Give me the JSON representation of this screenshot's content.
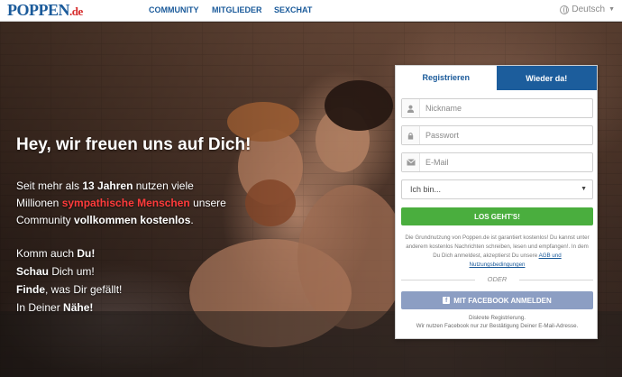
{
  "header": {
    "logo_main": "POPPEN",
    "logo_tld": ".de",
    "nav": [
      "COMMUNITY",
      "MITGLIEDER",
      "SEXCHAT"
    ],
    "language": "Deutsch"
  },
  "hero": {
    "headline": "Hey, wir freuen uns auf Dich!",
    "intro_part1": "Seit mehr als ",
    "intro_years": "13 Jahren",
    "intro_part2": " nutzen viele Millionen ",
    "intro_red": "sympathische Menschen",
    "intro_part3": " unsere Community ",
    "intro_bold_end": "vollkommen kostenlos",
    "intro_dot": ".",
    "cta": [
      {
        "bold": "",
        "plain": "Komm auch ",
        "bold2": "Du!"
      },
      {
        "bold": "Schau",
        "plain": " Dich um!",
        "bold2": ""
      },
      {
        "bold": "Finde",
        "plain": ", was Dir gefällt!",
        "bold2": ""
      },
      {
        "bold": "",
        "plain": "In Deiner ",
        "bold2": "Nähe!"
      }
    ]
  },
  "form": {
    "tab_register": "Registrieren",
    "tab_back": "Wieder da!",
    "nickname_placeholder": "Nickname",
    "password_placeholder": "Passwort",
    "email_placeholder": "E-Mail",
    "select_value": "Ich bin...",
    "submit_label": "LOS GEHT'S!",
    "legal_text": "Die Grundnutzung von Poppen.de ist garantiert kostenlos! Du kannst unter anderem kostenlos Nachrichten schreiben, lesen und empfangen!. In dem Du Dich anmeldest, akzeptierst Du unsere ",
    "legal_link": "AGB und Nutzungsbedingungen",
    "or_label": "ODER",
    "facebook_label": "MIT FACEBOOK ANMELDEN",
    "discreet_line1": "Diskrete Registrierung.",
    "discreet_line2": "Wir nutzen Facebook nur zur Bestätigung Deiner E-Mail-Adresse."
  },
  "colors": {
    "brand_blue": "#1c5d9c",
    "brand_red": "#d62b2b",
    "go_green": "#4aae3e",
    "facebook": "#8c9ec3"
  },
  "icons": [
    "user-icon",
    "lock-icon",
    "envelope-icon",
    "globe-icon",
    "facebook-icon",
    "chevron-down-icon"
  ]
}
